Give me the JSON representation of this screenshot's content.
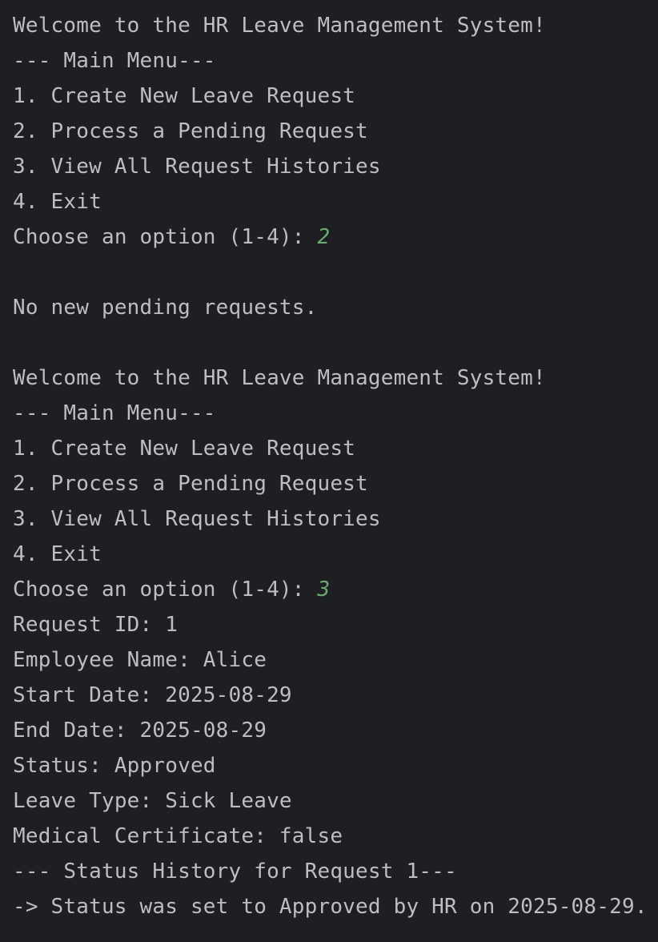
{
  "console": {
    "lines": [
      {
        "text": "Welcome to the HR Leave Management System!",
        "input": ""
      },
      {
        "text": "--- Main Menu---",
        "input": ""
      },
      {
        "text": "1. Create New Leave Request",
        "input": ""
      },
      {
        "text": "2. Process a Pending Request",
        "input": ""
      },
      {
        "text": "3. View All Request Histories",
        "input": ""
      },
      {
        "text": "4. Exit",
        "input": ""
      },
      {
        "text": "Choose an option (1-4): ",
        "input": "2"
      },
      {
        "text": "",
        "input": ""
      },
      {
        "text": "No new pending requests.",
        "input": ""
      },
      {
        "text": "",
        "input": ""
      },
      {
        "text": "Welcome to the HR Leave Management System!",
        "input": ""
      },
      {
        "text": "--- Main Menu---",
        "input": ""
      },
      {
        "text": "1. Create New Leave Request",
        "input": ""
      },
      {
        "text": "2. Process a Pending Request",
        "input": ""
      },
      {
        "text": "3. View All Request Histories",
        "input": ""
      },
      {
        "text": "4. Exit",
        "input": ""
      },
      {
        "text": "Choose an option (1-4): ",
        "input": "3"
      },
      {
        "text": "Request ID: 1",
        "input": ""
      },
      {
        "text": "Employee Name: Alice",
        "input": ""
      },
      {
        "text": "Start Date: 2025-08-29",
        "input": ""
      },
      {
        "text": "End Date: 2025-08-29",
        "input": ""
      },
      {
        "text": "Status: Approved",
        "input": ""
      },
      {
        "text": "Leave Type: Sick Leave",
        "input": ""
      },
      {
        "text": "Medical Certificate: false",
        "input": ""
      },
      {
        "text": "--- Status History for Request 1---",
        "input": ""
      },
      {
        "text": "-> Status was set to Approved by HR on 2025-08-29.",
        "input": ""
      }
    ]
  }
}
